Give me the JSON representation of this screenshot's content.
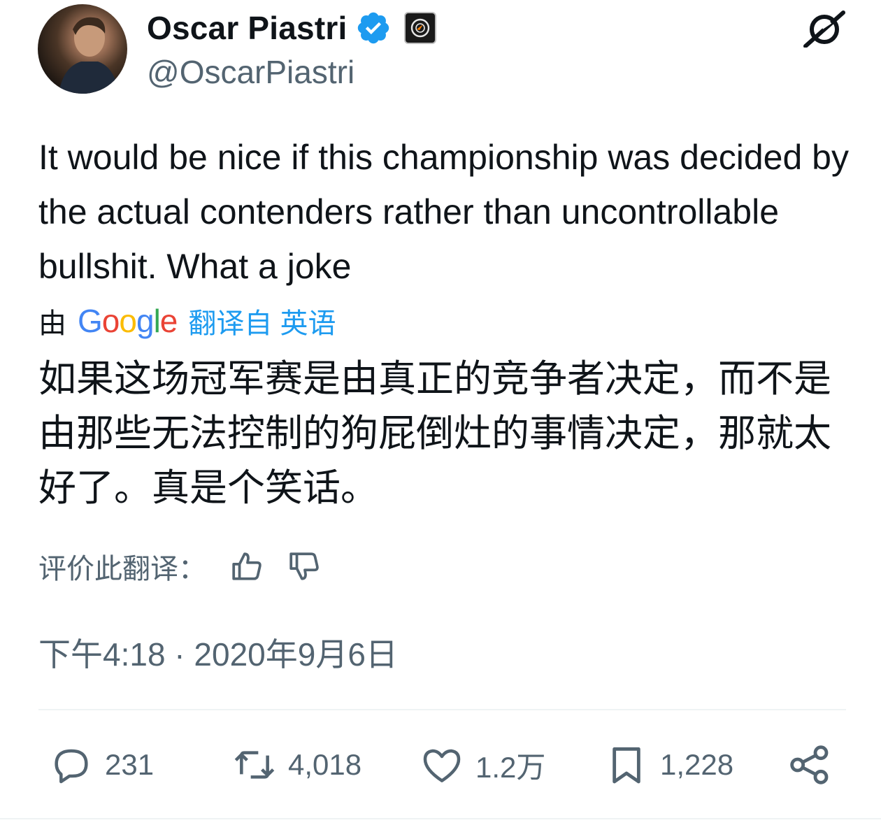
{
  "author": {
    "name": "Oscar Piastri",
    "handle": "@OscarPiastri"
  },
  "icons": {
    "verified": "verified-badge-icon",
    "affiliation": "affiliate-logo-icon",
    "grok": "grok-icon",
    "thumb_up": "thumbs-up-icon",
    "thumb_down": "thumbs-down-icon",
    "reply": "reply-icon",
    "retweet": "retweet-icon",
    "like": "heart-icon",
    "bookmark": "bookmark-icon",
    "share": "share-icon"
  },
  "tweet": {
    "text": "It would be nice if this championship was decided by the actual contenders rather than uncontrollable bullshit. What a joke"
  },
  "translation": {
    "by": "由",
    "google": "Google",
    "link": "翻译自 英语",
    "text": "如果这场冠军赛是由真正的竞争者决定，而不是由那些无法控制的狗屁倒灶的事情决定，那就太好了。真是个笑话。",
    "rate_label": "评价此翻译："
  },
  "timestamp": "下午4:18 · 2020年9月6日",
  "stats": {
    "replies": "231",
    "retweets": "4,018",
    "likes": "1.2万",
    "bookmarks": "1,228"
  },
  "colors": {
    "text": "#0f1419",
    "secondary": "#536471",
    "link": "#1d9bf0",
    "verified": "#1d9bf0"
  }
}
